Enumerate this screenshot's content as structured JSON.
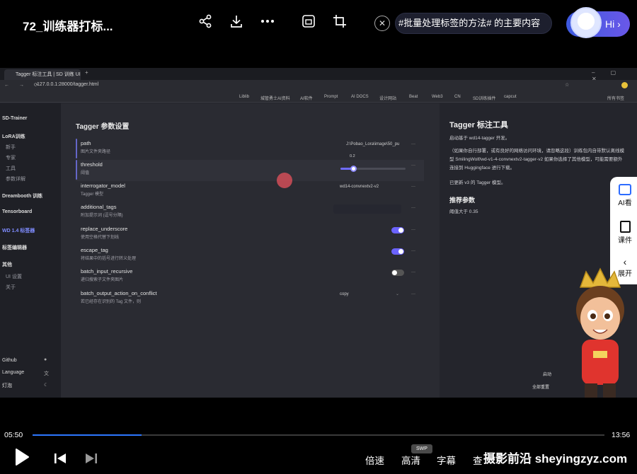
{
  "player": {
    "video_title": "72_训练器打标...",
    "search_query": "#批量处理标签的方法# 的主要内容",
    "hi_label": "Hi",
    "current_time": "05:50",
    "total_time": "13:56",
    "progress": 0.19,
    "bottom": {
      "speed_label": "倍速",
      "quality_label": "高清",
      "quality_badge": "SWP",
      "subtitle_label": "字幕",
      "more_label": "查",
      "watermark": "摄影前沿 sheyingzyz.com"
    },
    "side_panel": {
      "ai_label": "AI看",
      "courseware_label": "课件",
      "expand_label": "展开"
    }
  },
  "browser": {
    "tab_title": "Tagger 标注工具 | SD 训练 UI",
    "url": "127.0.0.1:28000/tagger.html",
    "bookmarks": [
      "Liblib",
      "城管勇士AI资料",
      "AI软件",
      "Prompt",
      "AI DOCS",
      "设计网站",
      "Beat",
      "Web3",
      "CN",
      "SD训练插件",
      "capcut",
      "所有书签"
    ]
  },
  "sidebar": {
    "app_title": "SD-Trainer",
    "lora_header": "LoRA训练",
    "lora_items": [
      "新手",
      "专家",
      "工具",
      "参数详解"
    ],
    "dreambooth": "Dreambooth 训练",
    "tensorboard": "Tensorboard",
    "wd_tagger": "WD 1.4 标签器",
    "tag_editor": "标签编辑器",
    "other_header": "其他",
    "other_items": [
      "UI 设置",
      "关于"
    ],
    "github": "Github",
    "language": "Language",
    "theme": "灯泡"
  },
  "settings": {
    "section_title": "Tagger 参数设置",
    "rows": [
      {
        "name": "path",
        "desc": "图片文件夹路径",
        "value": "J:\\Pobao_Lora\\image\\50_pu"
      },
      {
        "name": "threshold",
        "desc": "阈值",
        "value": "0.2",
        "slider": 0.1
      },
      {
        "name": "interrogator_model",
        "desc": "Tagger 模型",
        "value": "wd14-convnextv2-v2"
      },
      {
        "name": "additional_tags",
        "desc": "附加提示词 (逗号分隔)",
        "value": ""
      },
      {
        "name": "replace_underscore",
        "desc": "使用空格代替下划线",
        "toggle": true
      },
      {
        "name": "escape_tag",
        "desc": "将结果中的括号进行转义处理",
        "toggle": true
      },
      {
        "name": "batch_input_recursive",
        "desc": "递归搜索子文件夹图片",
        "toggle": false
      },
      {
        "name": "batch_output_action_on_conflict",
        "desc": "若已经存在识别的 Tag 文件，则",
        "value": "copy"
      }
    ]
  },
  "info": {
    "title": "Tagger 标注工具",
    "line1": "启动基于 wd14-tagger 开发。",
    "line2": "（如果你自行部署，或有良好的网络访问环境，请忽略这段）训练包内自带默认离线模型 SmilingWolf/wd-v1-4-convnextv2-tagger-v2 如果你选择了其他模型，可能需要额外连接到 Huggingface 进行下载。",
    "line3": "已更新 v3 的 Tagger 模型。",
    "rec_title": "推荐参数",
    "rec_text": "阈值大于 0.35",
    "start_button": "启动",
    "reset_button": "全部重置"
  }
}
